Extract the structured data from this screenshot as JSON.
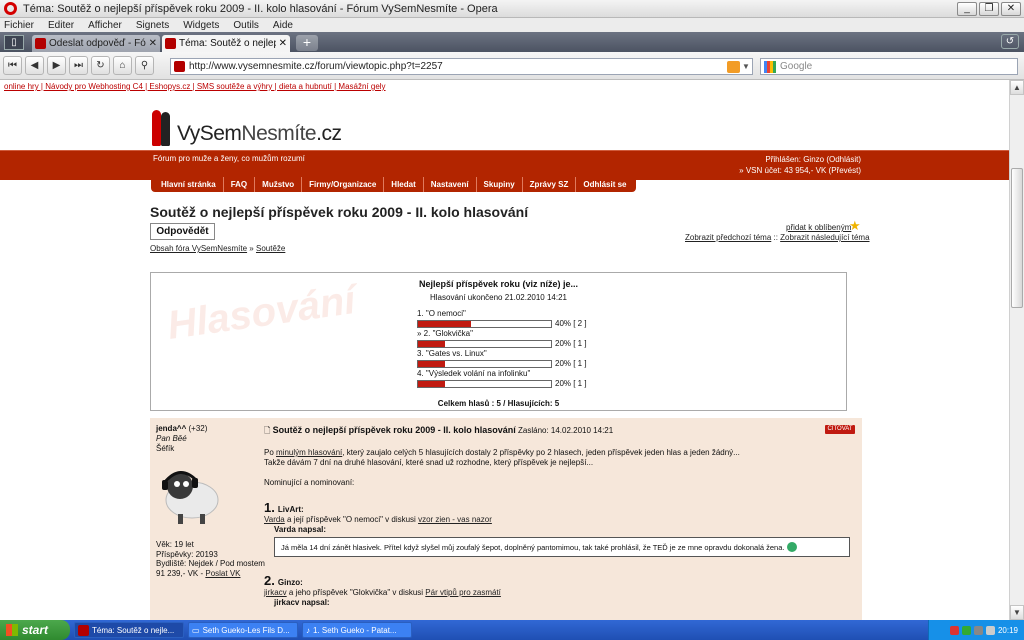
{
  "window": {
    "title": "Téma: Soutěž o nejlepší příspěvek roku 2009 - II. kolo hlasování - Fórum VySemNesmíte - Opera",
    "btn_min": "_",
    "btn_max": "❐",
    "btn_close": "✕"
  },
  "menu": [
    "Fichier",
    "Editer",
    "Afficher",
    "Signets",
    "Widgets",
    "Outils",
    "Aide"
  ],
  "tabs": [
    {
      "label": "Odeslat odpověď - Fórum..."
    },
    {
      "label": "Téma: Soutěž o nejlepší ..."
    }
  ],
  "toolbar": {
    "url": "http://www.vysemnesmite.cz/forum/viewtopic.php?t=2257",
    "search_placeholder": "Google"
  },
  "toplinks": "online hry | Návody pro Webhosting C4 | Eshopys.cz | SMS soutěže a výhry | dieta a hubnutí | Masážní gely",
  "site": {
    "logo_a": "VySem",
    "logo_b": "Nesmíte",
    "logo_c": ".cz",
    "tagline": "Fórum pro muže a ženy, co mužům rozumí",
    "user_line1": "Přihlášen: Ginzo (Odhlásit)",
    "user_line2": "» VSN účet: 43 954,- VK (Převést)",
    "nav": [
      "Hlavní stránka",
      "FAQ",
      "Mužstvo",
      "Firmy/Organizace",
      "Hledat",
      "Nastavení",
      "Skupiny",
      "Zprávy SZ",
      "Odhlásit se"
    ]
  },
  "topic": {
    "title": "Soutěž o nejlepší příspěvek roku 2009 - II. kolo hlasování",
    "reply_label": "Odpovědět",
    "fav_link": "přidat k oblíbeným",
    "prev": "Zobrazit předchozí téma",
    "sep": " :: ",
    "next": "Zobrazit následující téma",
    "crumb_home": "Obsah fóra VySemNesmíte",
    "crumb_sep": " » ",
    "crumb_cat": "Soutěže"
  },
  "poll": {
    "watermark": "Hlasování",
    "question": "Nejlepší příspěvek roku (viz níže) je...",
    "ended": "Hlasování ukončeno 21.02.2010 14:21",
    "total": "Celkem hlasů : 5 / Hlasujících: 5",
    "options": [
      {
        "label": "1. \"O nemoci\"",
        "pct": 40,
        "result": "40% [ 2 ]"
      },
      {
        "label": "» 2. \"Glokvička\"",
        "pct": 20,
        "result": "20% [ 1 ]"
      },
      {
        "label": "3. \"Gates vs. Linux\"",
        "pct": 20,
        "result": "20% [ 1 ]"
      },
      {
        "label": "4. \"Výsledek volání na infolinku\"",
        "pct": 20,
        "result": "20% [ 1 ]"
      }
    ]
  },
  "post": {
    "author": "jenda^^",
    "karma": "(+32)",
    "rank": "Pan Běé",
    "role": "Šéfík",
    "age": "Věk: 19 let",
    "posts": "Příspěvky: 20193",
    "location": "Bydliště: Nejdek / Pod mostem",
    "money": "91 239,- VK - ",
    "money_link": "Poslat VK",
    "title": "Soutěž o nejlepší příspěvek roku 2009 - II. kolo hlasování",
    "date": "Zasláno: 14.02.2010 14:21",
    "quote_btn": "CITOVAT",
    "p1_a": "Po ",
    "p1_link": "minulým hlasování",
    "p1_b": ", který zaujalo celých 5 hlasujících dostaly 2 příspěvky po 2 hlasech, jeden příspěvek jeden hlas a jeden žádný...",
    "p2": "Takže dávám 7 dní na druhé hlasování, které snad už rozhodne, který příspěvek je nejlepší...",
    "p3": "Nominující a nominovaní:",
    "n1_num": "1.",
    "n1_name": "LivArt:",
    "n1_link1": "Varda",
    "n1_text": " a její příspěvek \"O nemoci\" v diskusi ",
    "n1_link2": "vzor zien - vas nazor",
    "n1_quote_head": "Varda napsal:",
    "n1_quote": "Já měla 14 dní zánět hlasivek. Přítel když slyšel můj zoufalý šepot, doplněný pantomimou, tak také prohlásil, že TEĎ je ze mne opravdu dokonalá žena.",
    "n2_num": "2.",
    "n2_name": "Ginzo:",
    "n2_link1": "jirkacv",
    "n2_text": " a jeho příspěvek \"Glokvička\" v diskusi ",
    "n2_link2": "Pár vtipů pro zasmátí",
    "n2_quote_head": "jirkacv napsal:"
  },
  "taskbar": {
    "start": "start",
    "tasks": [
      "Téma: Soutěž o nejle...",
      "Seth Gueko-Les Fils D...",
      "1. Seth Gueko - Patat..."
    ],
    "clock": "20:19"
  }
}
